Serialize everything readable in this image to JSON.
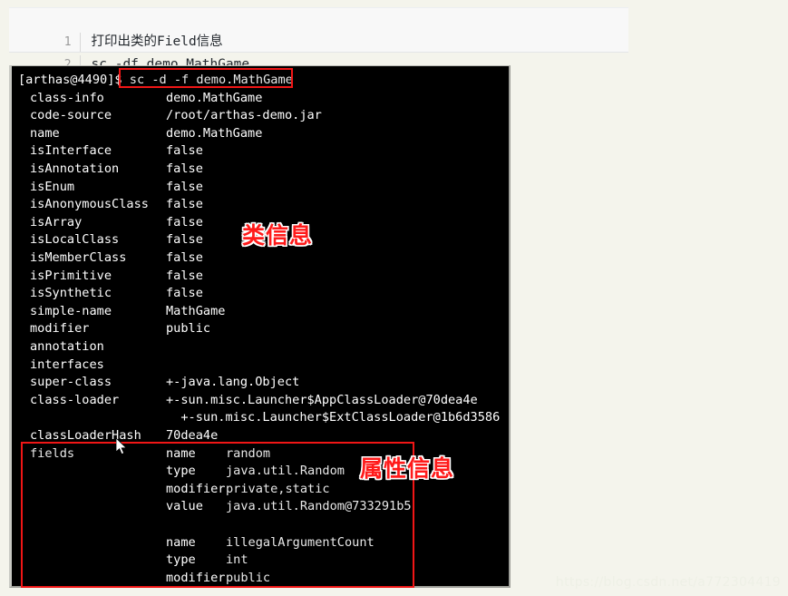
{
  "code_snippet": {
    "lines": [
      {
        "number": "1",
        "text": "打印出类的Field信息"
      },
      {
        "number": "2",
        "text": "sc -df demo.MathGame"
      }
    ]
  },
  "terminal": {
    "prompt": "[arthas@4490]$ ",
    "command": "sc -d -f demo.MathGame",
    "rows": [
      {
        "key": "class-info",
        "value": "demo.MathGame"
      },
      {
        "key": "code-source",
        "value": "/root/arthas-demo.jar"
      },
      {
        "key": "name",
        "value": "demo.MathGame"
      },
      {
        "key": "isInterface",
        "value": "false"
      },
      {
        "key": "isAnnotation",
        "value": "false"
      },
      {
        "key": "isEnum",
        "value": "false"
      },
      {
        "key": "isAnonymousClass",
        "value": "false"
      },
      {
        "key": "isArray",
        "value": "false"
      },
      {
        "key": "isLocalClass",
        "value": "false"
      },
      {
        "key": "isMemberClass",
        "value": "false"
      },
      {
        "key": "isPrimitive",
        "value": "false"
      },
      {
        "key": "isSynthetic",
        "value": "false"
      },
      {
        "key": "simple-name",
        "value": "MathGame"
      },
      {
        "key": "modifier",
        "value": "public"
      },
      {
        "key": "annotation",
        "value": ""
      },
      {
        "key": "interfaces",
        "value": ""
      },
      {
        "key": "super-class",
        "value": "+-java.lang.Object"
      },
      {
        "key": "class-loader",
        "value": "+-sun.misc.Launcher$AppClassLoader@70dea4e"
      },
      {
        "key": "",
        "value": "  +-sun.misc.Launcher$ExtClassLoader@1b6d3586"
      },
      {
        "key": "classLoaderHash",
        "value": "70dea4e"
      }
    ],
    "fields_label": "fields",
    "fields": [
      [
        {
          "key": "name",
          "value": "random"
        },
        {
          "key": "type",
          "value": "java.util.Random"
        },
        {
          "key": "modifier",
          "value": "private,static"
        },
        {
          "key": "value",
          "value": "java.util.Random@733291b5"
        }
      ],
      [
        {
          "key": "name",
          "value": "illegalArgumentCount"
        },
        {
          "key": "type",
          "value": "int"
        },
        {
          "key": "modifier",
          "value": "public"
        }
      ]
    ]
  },
  "annotations": {
    "class_info_label": "类信息",
    "field_info_label": "属性信息",
    "highlight_color": "#f01616",
    "label_color": "#ff1a1a"
  },
  "watermark": {
    "text": "https://blog.csdn.net/a772304419"
  }
}
